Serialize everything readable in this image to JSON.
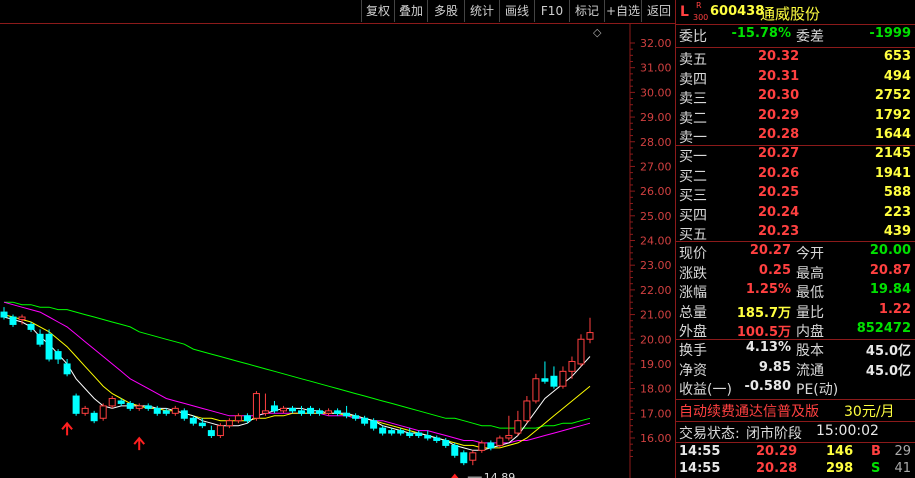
{
  "toolbar": {
    "buttons": [
      "复权",
      "叠加",
      "多股",
      "统计",
      "画线",
      "F10",
      "标记",
      "+自选",
      "返回"
    ]
  },
  "stock": {
    "market_tag": "L",
    "r_tag": "R",
    "index_tag": "300",
    "code": "600438",
    "name": "通威股份"
  },
  "ratio": {
    "label1": "委比",
    "value1": "-15.78%",
    "label2": "委差",
    "value2": "-1999"
  },
  "asks": [
    {
      "label": "卖五",
      "price": "20.32",
      "vol": "653"
    },
    {
      "label": "卖四",
      "price": "20.31",
      "vol": "494"
    },
    {
      "label": "卖三",
      "price": "20.30",
      "vol": "2752"
    },
    {
      "label": "卖二",
      "price": "20.29",
      "vol": "1792"
    },
    {
      "label": "卖一",
      "price": "20.28",
      "vol": "1644"
    }
  ],
  "bids": [
    {
      "label": "买一",
      "price": "20.27",
      "vol": "2145"
    },
    {
      "label": "买二",
      "price": "20.26",
      "vol": "1941"
    },
    {
      "label": "买三",
      "price": "20.25",
      "vol": "588"
    },
    {
      "label": "买四",
      "price": "20.24",
      "vol": "223"
    },
    {
      "label": "买五",
      "price": "20.23",
      "vol": "439"
    }
  ],
  "quote": [
    {
      "l1": "现价",
      "v1": "20.27",
      "l2": "今开",
      "v2": "20.00"
    },
    {
      "l1": "涨跌",
      "v1": "0.25",
      "l2": "最高",
      "v2": "20.87"
    },
    {
      "l1": "涨幅",
      "v1": "1.25%",
      "l2": "最低",
      "v2": "19.84"
    },
    {
      "l1": "总量",
      "v1": "185.7万",
      "l2": "量比",
      "v2": "1.22"
    },
    {
      "l1": "外盘",
      "v1": "100.5万",
      "l2": "内盘",
      "v2": "852472"
    }
  ],
  "fund": [
    {
      "l1": "换手",
      "v1": "4.13%",
      "l2": "股本",
      "v2": "45.0亿"
    },
    {
      "l1": "净资",
      "v1": "9.85",
      "l2": "流通",
      "v2": "45.0亿"
    },
    {
      "l1": "收益(一)",
      "v1": "-0.580",
      "l2": "PE(动)",
      "v2": ""
    }
  ],
  "promo": {
    "text": "自动续费通达信普及版",
    "price": "30元/月"
  },
  "status": {
    "label": "交易状态:",
    "value": "闭市阶段",
    "time": "15:00:02"
  },
  "ticks": [
    {
      "time": "14:55",
      "price": "20.29",
      "vol": "146",
      "side": "B",
      "num": "29"
    },
    {
      "time": "14:55",
      "price": "20.28",
      "vol": "298",
      "side": "S",
      "num": "41"
    }
  ],
  "colors": {
    "up": "#ff4040",
    "down": "#00ffff",
    "ma5": "#ffffff",
    "ma10": "#ffff00",
    "ma20": "#ff00ff",
    "ma60": "#00ff00",
    "grid": "#8b1a1a"
  },
  "chart_data": {
    "type": "candlestick",
    "y_ticks": [
      "32.00",
      "31.00",
      "30.00",
      "29.00",
      "28.00",
      "27.00",
      "26.00",
      "25.00",
      "24.00",
      "23.00",
      "22.00",
      "21.00",
      "20.00",
      "19.00",
      "18.00",
      "17.00",
      "16.00"
    ],
    "ylim": [
      15.3,
      32.4
    ],
    "low_annotation": "14.89",
    "candles": [
      {
        "o": 21.1,
        "h": 21.3,
        "l": 20.8,
        "c": 20.9
      },
      {
        "o": 20.9,
        "h": 21.0,
        "l": 20.5,
        "c": 20.6
      },
      {
        "o": 20.8,
        "h": 21.0,
        "l": 20.6,
        "c": 20.9
      },
      {
        "o": 20.6,
        "h": 20.7,
        "l": 20.3,
        "c": 20.4
      },
      {
        "o": 20.2,
        "h": 20.4,
        "l": 19.7,
        "c": 19.8
      },
      {
        "o": 20.2,
        "h": 20.4,
        "l": 19.1,
        "c": 19.2
      },
      {
        "o": 19.5,
        "h": 19.6,
        "l": 19.0,
        "c": 19.2
      },
      {
        "o": 19.0,
        "h": 19.2,
        "l": 18.5,
        "c": 18.6
      },
      {
        "o": 17.7,
        "h": 17.8,
        "l": 16.9,
        "c": 17.0
      },
      {
        "o": 17.0,
        "h": 17.3,
        "l": 16.9,
        "c": 17.2
      },
      {
        "o": 17.0,
        "h": 17.1,
        "l": 16.6,
        "c": 16.7
      },
      {
        "o": 16.8,
        "h": 17.4,
        "l": 16.7,
        "c": 17.3
      },
      {
        "o": 17.3,
        "h": 17.7,
        "l": 17.2,
        "c": 17.6
      },
      {
        "o": 17.5,
        "h": 17.6,
        "l": 17.3,
        "c": 17.4
      },
      {
        "o": 17.4,
        "h": 17.5,
        "l": 17.1,
        "c": 17.2
      },
      {
        "o": 17.2,
        "h": 17.4,
        "l": 17.1,
        "c": 17.3
      },
      {
        "o": 17.3,
        "h": 17.4,
        "l": 17.1,
        "c": 17.2
      },
      {
        "o": 17.2,
        "h": 17.3,
        "l": 16.9,
        "c": 17.0
      },
      {
        "o": 17.1,
        "h": 17.2,
        "l": 16.9,
        "c": 17.0
      },
      {
        "o": 17.0,
        "h": 17.3,
        "l": 16.9,
        "c": 17.2
      },
      {
        "o": 17.1,
        "h": 17.2,
        "l": 16.7,
        "c": 16.8
      },
      {
        "o": 16.8,
        "h": 16.9,
        "l": 16.5,
        "c": 16.6
      },
      {
        "o": 16.6,
        "h": 16.8,
        "l": 16.4,
        "c": 16.5
      },
      {
        "o": 16.3,
        "h": 16.5,
        "l": 16.0,
        "c": 16.1
      },
      {
        "o": 16.1,
        "h": 16.6,
        "l": 16.0,
        "c": 16.5
      },
      {
        "o": 16.5,
        "h": 16.8,
        "l": 16.4,
        "c": 16.7
      },
      {
        "o": 16.7,
        "h": 17.0,
        "l": 16.6,
        "c": 16.9
      },
      {
        "o": 16.9,
        "h": 17.0,
        "l": 16.6,
        "c": 16.7
      },
      {
        "o": 16.8,
        "h": 17.9,
        "l": 16.7,
        "c": 17.8
      },
      {
        "o": 17.0,
        "h": 17.8,
        "l": 16.9,
        "c": 17.1
      },
      {
        "o": 17.3,
        "h": 17.5,
        "l": 17.0,
        "c": 17.1
      },
      {
        "o": 17.1,
        "h": 17.3,
        "l": 17.0,
        "c": 17.2
      },
      {
        "o": 17.2,
        "h": 17.3,
        "l": 17.0,
        "c": 17.1
      },
      {
        "o": 17.1,
        "h": 17.3,
        "l": 16.9,
        "c": 17.0
      },
      {
        "o": 17.2,
        "h": 17.3,
        "l": 16.9,
        "c": 17.0
      },
      {
        "o": 17.1,
        "h": 17.2,
        "l": 16.9,
        "c": 17.0
      },
      {
        "o": 17.0,
        "h": 17.2,
        "l": 16.9,
        "c": 17.1
      },
      {
        "o": 17.1,
        "h": 17.2,
        "l": 16.9,
        "c": 17.0
      },
      {
        "o": 17.0,
        "h": 17.3,
        "l": 16.8,
        "c": 16.9
      },
      {
        "o": 16.9,
        "h": 17.0,
        "l": 16.7,
        "c": 16.8
      },
      {
        "o": 16.8,
        "h": 16.9,
        "l": 16.5,
        "c": 16.6
      },
      {
        "o": 16.7,
        "h": 16.8,
        "l": 16.3,
        "c": 16.4
      },
      {
        "o": 16.4,
        "h": 16.5,
        "l": 16.1,
        "c": 16.2
      },
      {
        "o": 16.3,
        "h": 16.4,
        "l": 16.1,
        "c": 16.2
      },
      {
        "o": 16.3,
        "h": 16.4,
        "l": 16.1,
        "c": 16.2
      },
      {
        "o": 16.2,
        "h": 16.4,
        "l": 16.0,
        "c": 16.1
      },
      {
        "o": 16.2,
        "h": 16.3,
        "l": 16.0,
        "c": 16.1
      },
      {
        "o": 16.1,
        "h": 16.3,
        "l": 15.9,
        "c": 16.0
      },
      {
        "o": 16.0,
        "h": 16.1,
        "l": 15.8,
        "c": 15.9
      },
      {
        "o": 15.9,
        "h": 16.0,
        "l": 15.6,
        "c": 15.7
      },
      {
        "o": 15.7,
        "h": 15.8,
        "l": 15.2,
        "c": 15.3
      },
      {
        "o": 15.4,
        "h": 15.5,
        "l": 14.9,
        "c": 15.0
      },
      {
        "o": 15.1,
        "h": 15.5,
        "l": 14.9,
        "c": 15.4
      },
      {
        "o": 15.5,
        "h": 15.9,
        "l": 15.4,
        "c": 15.8
      },
      {
        "o": 15.8,
        "h": 15.9,
        "l": 15.5,
        "c": 15.6
      },
      {
        "o": 15.7,
        "h": 16.1,
        "l": 15.6,
        "c": 16.0
      },
      {
        "o": 16.0,
        "h": 16.9,
        "l": 15.9,
        "c": 16.1
      },
      {
        "o": 16.2,
        "h": 17.1,
        "l": 16.1,
        "c": 16.7
      },
      {
        "o": 16.7,
        "h": 17.7,
        "l": 16.6,
        "c": 17.5
      },
      {
        "o": 17.5,
        "h": 18.6,
        "l": 17.4,
        "c": 18.4
      },
      {
        "o": 18.4,
        "h": 19.1,
        "l": 18.2,
        "c": 18.3
      },
      {
        "o": 18.5,
        "h": 18.9,
        "l": 18.0,
        "c": 18.1
      },
      {
        "o": 18.1,
        "h": 18.9,
        "l": 18.0,
        "c": 18.7
      },
      {
        "o": 18.7,
        "h": 19.3,
        "l": 18.4,
        "c": 19.1
      },
      {
        "o": 19.0,
        "h": 20.2,
        "l": 18.9,
        "c": 20.0
      },
      {
        "o": 20.0,
        "h": 20.87,
        "l": 19.84,
        "c": 20.27
      }
    ],
    "ma5": [
      20.9,
      20.8,
      20.7,
      20.5,
      20.1,
      19.8,
      19.4,
      19.0,
      18.4,
      18.0,
      17.6,
      17.3,
      17.2,
      17.3,
      17.3,
      17.3,
      17.3,
      17.2,
      17.2,
      17.1,
      17.0,
      16.9,
      16.7,
      16.6,
      16.5,
      16.5,
      16.5,
      16.6,
      16.9,
      17.0,
      17.1,
      17.2,
      17.2,
      17.2,
      17.1,
      17.1,
      17.0,
      17.0,
      17.0,
      16.9,
      16.8,
      16.7,
      16.5,
      16.4,
      16.3,
      16.2,
      16.2,
      16.1,
      16.0,
      15.9,
      15.7,
      15.6,
      15.5,
      15.5,
      15.6,
      15.7,
      15.8,
      16.1,
      16.6,
      17.1,
      17.6,
      17.9,
      18.2,
      18.5,
      18.9,
      19.3
    ],
    "ma10": [
      21.0,
      20.9,
      20.8,
      20.7,
      20.5,
      20.3,
      20.0,
      19.7,
      19.3,
      18.9,
      18.5,
      18.1,
      17.8,
      17.6,
      17.4,
      17.3,
      17.2,
      17.2,
      17.1,
      17.1,
      17.0,
      16.9,
      16.8,
      16.8,
      16.7,
      16.7,
      16.7,
      16.7,
      16.8,
      16.8,
      16.9,
      16.9,
      17.0,
      17.0,
      17.0,
      17.0,
      17.0,
      17.0,
      16.9,
      16.9,
      16.8,
      16.7,
      16.6,
      16.5,
      16.4,
      16.3,
      16.2,
      16.1,
      16.0,
      15.9,
      15.8,
      15.7,
      15.7,
      15.6,
      15.6,
      15.6,
      15.7,
      15.8,
      16.0,
      16.3,
      16.6,
      16.9,
      17.2,
      17.5,
      17.8,
      18.1
    ],
    "ma20": [
      21.5,
      21.4,
      21.3,
      21.2,
      21.1,
      20.9,
      20.7,
      20.5,
      20.2,
      19.9,
      19.6,
      19.3,
      19.0,
      18.7,
      18.4,
      18.2,
      18.0,
      17.8,
      17.6,
      17.5,
      17.4,
      17.3,
      17.2,
      17.1,
      17.0,
      16.9,
      16.9,
      16.9,
      16.9,
      17.0,
      17.0,
      17.0,
      17.0,
      17.0,
      17.0,
      17.0,
      16.9,
      16.9,
      16.9,
      16.8,
      16.8,
      16.7,
      16.7,
      16.6,
      16.5,
      16.4,
      16.3,
      16.3,
      16.2,
      16.1,
      16.0,
      15.9,
      15.9,
      15.8,
      15.8,
      15.8,
      15.8,
      15.9,
      15.9,
      16.0,
      16.1,
      16.2,
      16.3,
      16.4,
      16.5,
      16.6
    ],
    "ma60": [
      21.5,
      21.5,
      21.4,
      21.4,
      21.3,
      21.3,
      21.2,
      21.2,
      21.1,
      21.0,
      20.9,
      20.8,
      20.7,
      20.6,
      20.5,
      20.3,
      20.2,
      20.1,
      20.0,
      19.9,
      19.8,
      19.6,
      19.5,
      19.4,
      19.3,
      19.2,
      19.1,
      19.0,
      18.9,
      18.8,
      18.7,
      18.6,
      18.5,
      18.4,
      18.3,
      18.2,
      18.1,
      18.0,
      17.9,
      17.8,
      17.7,
      17.6,
      17.5,
      17.4,
      17.3,
      17.2,
      17.1,
      17.0,
      16.9,
      16.8,
      16.8,
      16.7,
      16.6,
      16.5,
      16.5,
      16.4,
      16.4,
      16.4,
      16.4,
      16.4,
      16.5,
      16.5,
      16.6,
      16.6,
      16.7,
      16.8
    ]
  }
}
